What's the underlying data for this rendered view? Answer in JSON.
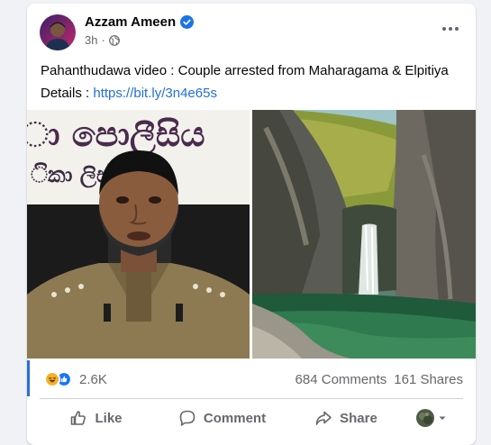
{
  "post": {
    "author": "Azzam Ameen",
    "time": "3h",
    "text_line1": "Pahanthudawa video : Couple arrested from Maharagama & Elpitiya",
    "details_label": "Details :",
    "link_text": "https://bit.ly/3n4e65s",
    "photo_left_sign_line1": "ා පොලීසිය",
    "photo_left_sign_line2": "ිකා    ලිස්"
  },
  "stats": {
    "reaction_count": "2.6K",
    "comments": "684 Comments",
    "shares": "161 Shares"
  },
  "actions": {
    "like": "Like",
    "comment": "Comment",
    "share": "Share"
  },
  "icons": {
    "verified": "verified-badge-icon",
    "globe": "globe-icon",
    "more": "more-options-icon",
    "haha": "haha-reaction-icon",
    "like_reaction": "like-reaction-icon",
    "like": "thumbs-up-icon",
    "comment": "comment-bubble-icon",
    "share": "share-arrow-icon",
    "caret": "caret-down-icon"
  },
  "colors": {
    "link": "#216fdb",
    "secondary_text": "#65676b",
    "verified": "#1b74e4",
    "like_blue": "#1877f2",
    "haha_yellow": "#f7b125"
  }
}
